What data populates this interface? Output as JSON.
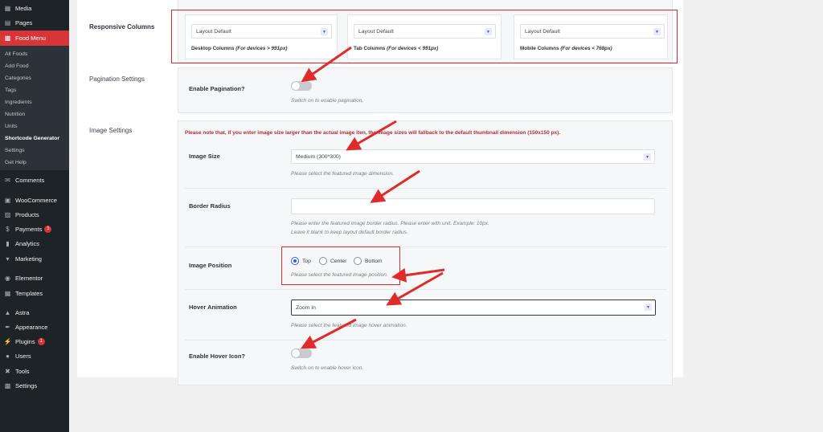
{
  "sidebar": {
    "top_items": [
      {
        "label": "Media",
        "icon": "media-icon"
      },
      {
        "label": "Pages",
        "icon": "pages-icon"
      },
      {
        "label": "Food Menu",
        "icon": "food-menu-icon"
      }
    ],
    "submenu": [
      "All Foods",
      "Add Food",
      "Categories",
      "Tags",
      "Ingredients",
      "Nutrition",
      "Units",
      "Shortcode Generator",
      "Settings",
      "Get Help"
    ],
    "current_submenu": "Shortcode Generator",
    "items": [
      {
        "label": "Comments",
        "icon": "comments-icon"
      },
      {
        "label": "WooCommerce",
        "icon": "woocommerce-icon"
      },
      {
        "label": "Products",
        "icon": "products-icon"
      },
      {
        "label": "Payments",
        "icon": "payments-icon",
        "badge": "1"
      },
      {
        "label": "Analytics",
        "icon": "analytics-icon"
      },
      {
        "label": "Marketing",
        "icon": "marketing-icon"
      },
      {
        "label": "Elementor",
        "icon": "elementor-icon"
      },
      {
        "label": "Templates",
        "icon": "templates-icon"
      },
      {
        "label": "Astra",
        "icon": "astra-icon"
      },
      {
        "label": "Appearance",
        "icon": "appearance-icon"
      },
      {
        "label": "Plugins",
        "icon": "plugins-icon",
        "badge": "1"
      },
      {
        "label": "Users",
        "icon": "users-icon"
      },
      {
        "label": "Tools",
        "icon": "tools-icon"
      },
      {
        "label": "Settings",
        "icon": "settings-icon"
      }
    ]
  },
  "responsive": {
    "label": "Responsive Columns",
    "columns": [
      {
        "value": "Layout Default",
        "caption": "Desktop Columns",
        "note": "(For devices > 991px)"
      },
      {
        "value": "Layout Default",
        "caption": "Tab Columns",
        "note": "(For devices < 991px)"
      },
      {
        "value": "Layout Default",
        "caption": "Mobile Columns",
        "note": "(For devices < 768px)"
      }
    ]
  },
  "pagination": {
    "label": "Pagination Settings",
    "field": "Enable Pagination?",
    "help": "Switch on to enable pagination.",
    "enabled": false
  },
  "image": {
    "label": "Image Settings",
    "notice": "Please note that, if you enter image size larger than the actual image iten, the image sizes will fallback to the default thumbnail dimension (150x150 px).",
    "size_label": "Image Size",
    "size_value": "Medium (300*300)",
    "size_help": "Please select the featured image dimension.",
    "radius_label": "Border Radius",
    "radius_value": "",
    "radius_help_1": "Please enter the featured image border radius. Please enter with unit. Example: 10px.",
    "radius_help_2": "Leave it blank to keep layout default border radius.",
    "position_label": "Image Position",
    "positions": [
      "Top",
      "Center",
      "Bottom"
    ],
    "position_selected": "Top",
    "position_help": "Please select the featured image position.",
    "hover_label": "Hover Animation",
    "hover_value": "Zoom In",
    "hover_help": "Please select the featured image hover animation.",
    "hover_icon_label": "Enable Hover Icon?",
    "hover_icon_help": "Switch on to enable hover icon.",
    "hover_icon_enabled": false
  },
  "colors": {
    "accent": "#3858e9",
    "highlight": "#e02b2b",
    "sidebar": "#1d2327",
    "active_menu": "#d63638"
  }
}
